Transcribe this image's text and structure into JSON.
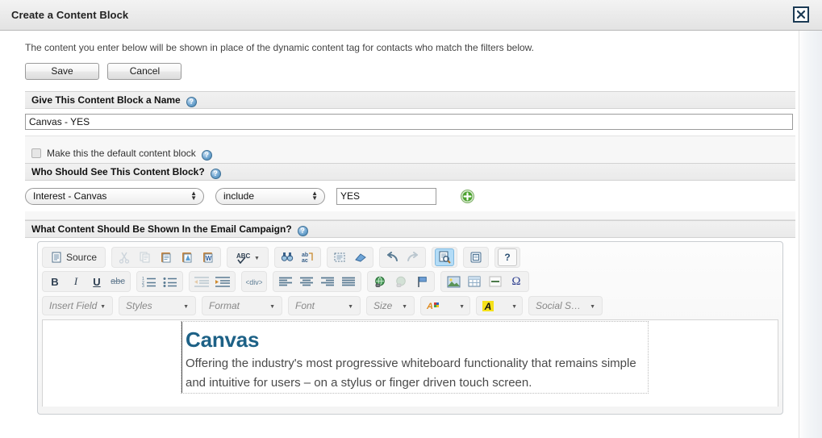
{
  "window": {
    "title": "Create a Content Block",
    "close_label": "x"
  },
  "intro": {
    "text": "The content you enter below will be shown in place of the dynamic content tag for contacts who match the filters below."
  },
  "actions": {
    "save_label": "Save",
    "cancel_label": "Cancel"
  },
  "help_glyph": "?",
  "sections": {
    "name": {
      "header": "Give This Content Block a Name",
      "input_value": "Canvas - YES",
      "input_placeholder": ""
    },
    "default_block": {
      "label": "Make this the default content block",
      "checked": false
    },
    "audience": {
      "header": "Who Should See This Content Block?",
      "field_select": "Interest - Canvas",
      "operator_select": "include",
      "value_input": "YES",
      "value_placeholder": "",
      "add_button": "+"
    },
    "content": {
      "header": "What Content Should Be Shown In the Email Campaign?"
    }
  },
  "editor": {
    "toolbar_row1": [
      {
        "name": "source-button",
        "label": "Source",
        "state": "normal"
      },
      {
        "name": "cut-icon",
        "label": "",
        "state": "disabled"
      },
      {
        "name": "copy-icon",
        "label": "",
        "state": "disabled"
      },
      {
        "name": "paste-icon",
        "label": "",
        "state": "normal"
      },
      {
        "name": "paste-text-icon",
        "label": "",
        "state": "normal"
      },
      {
        "name": "paste-from-word-icon",
        "label": "",
        "state": "normal"
      },
      {
        "name": "spell-check-icon",
        "label": "ABC",
        "state": "normal"
      },
      {
        "name": "find-icon",
        "label": "",
        "state": "normal"
      },
      {
        "name": "replace-icon",
        "label": "",
        "state": "normal"
      },
      {
        "name": "select-all-icon",
        "label": "",
        "state": "normal"
      },
      {
        "name": "remove-format-icon",
        "label": "",
        "state": "normal"
      },
      {
        "name": "undo-icon",
        "label": "",
        "state": "normal"
      },
      {
        "name": "redo-icon",
        "label": "",
        "state": "disabled"
      },
      {
        "name": "preview-icon",
        "label": "",
        "state": "active"
      },
      {
        "name": "templates-icon",
        "label": "",
        "state": "normal"
      },
      {
        "name": "about-icon",
        "label": "?",
        "state": "normal"
      }
    ],
    "toolbar_row2": [
      {
        "name": "bold-icon",
        "label": "B",
        "state": "normal"
      },
      {
        "name": "italic-icon",
        "label": "I",
        "state": "normal"
      },
      {
        "name": "underline-icon",
        "label": "U",
        "state": "normal"
      },
      {
        "name": "strikethrough-icon",
        "label": "abc",
        "state": "normal"
      },
      {
        "name": "numbered-list-icon",
        "label": "",
        "state": "normal"
      },
      {
        "name": "bulleted-list-icon",
        "label": "",
        "state": "normal"
      },
      {
        "name": "decrease-indent-icon",
        "label": "",
        "state": "disabled"
      },
      {
        "name": "increase-indent-icon",
        "label": "",
        "state": "normal"
      },
      {
        "name": "div-container-icon",
        "label": "",
        "state": "normal"
      },
      {
        "name": "align-left-icon",
        "label": "",
        "state": "normal"
      },
      {
        "name": "align-center-icon",
        "label": "",
        "state": "normal"
      },
      {
        "name": "align-right-icon",
        "label": "",
        "state": "normal"
      },
      {
        "name": "align-justify-icon",
        "label": "",
        "state": "normal"
      },
      {
        "name": "link-icon",
        "label": "",
        "state": "normal"
      },
      {
        "name": "unlink-icon",
        "label": "",
        "state": "disabled"
      },
      {
        "name": "anchor-icon",
        "label": "",
        "state": "normal"
      },
      {
        "name": "image-icon",
        "label": "",
        "state": "normal"
      },
      {
        "name": "table-icon",
        "label": "",
        "state": "normal"
      },
      {
        "name": "horizontal-rule-icon",
        "label": "",
        "state": "normal"
      },
      {
        "name": "special-character-icon",
        "label": "Ω",
        "state": "normal"
      }
    ],
    "toolbar_row3": [
      {
        "name": "insert-field-dropdown",
        "label": "Insert Field"
      },
      {
        "name": "styles-dropdown",
        "label": "Styles"
      },
      {
        "name": "format-dropdown",
        "label": "Format"
      },
      {
        "name": "font-dropdown",
        "label": "Font"
      },
      {
        "name": "size-dropdown",
        "label": "Size"
      },
      {
        "name": "text-color-dropdown",
        "label": "A"
      },
      {
        "name": "background-color-dropdown",
        "label": "A"
      },
      {
        "name": "social-share-dropdown",
        "label": "Social S…"
      }
    ],
    "content": {
      "heading": "Canvas",
      "paragraph": "Offering the industry's most progressive whiteboard functionality that remains simple and intuitive for users – on a stylus or finger driven touch screen."
    }
  },
  "colors": {
    "heading": "#1d6186",
    "accent_active": "#b3dcf7",
    "add_button": "#4ca22f"
  }
}
